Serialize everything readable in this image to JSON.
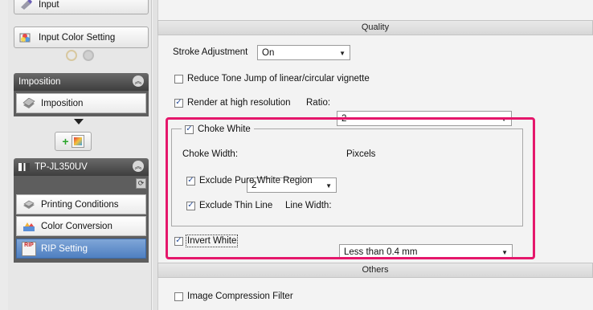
{
  "left_panel": {
    "input_label": "Input",
    "input_color_label": "Input Color Setting",
    "imposition_header": "Imposition",
    "imposition_item": "Imposition",
    "printer_header": "TP-JL350UV",
    "items": [
      {
        "label": "Printing Conditions"
      },
      {
        "label": "Color Conversion"
      },
      {
        "label": "RIP Setting"
      }
    ]
  },
  "quality": {
    "header": "Quality",
    "stroke_adjustment_label": "Stroke Adjustment",
    "stroke_adjustment_value": "On",
    "reduce_tone_jump_label": "Reduce Tone Jump of linear/circular vignette",
    "reduce_tone_jump_checked": false,
    "render_high_res_label": "Render at high resolution",
    "render_high_res_checked": true,
    "ratio_label": "Ratio:",
    "ratio_value": "2",
    "choke_white_label": "Choke White",
    "choke_white_checked": true,
    "choke_width_label": "Choke Width:",
    "choke_width_value": "2",
    "choke_width_unit": "Pixcels",
    "exclude_pure_white_label": "Exclude Pure White Region",
    "exclude_pure_white_checked": true,
    "exclude_thin_line_label": "Exclude Thin Line",
    "exclude_thin_line_checked": true,
    "line_width_label": "Line Width:",
    "line_width_value": "Less than 0.4 mm",
    "invert_white_label": "Invert White",
    "invert_white_checked": true
  },
  "others": {
    "header": "Others",
    "image_compression_label": "Image Compression Filter",
    "image_compression_checked": false
  },
  "colors": {
    "highlight": "#e5176b",
    "active_item": "#4f7fc1"
  }
}
